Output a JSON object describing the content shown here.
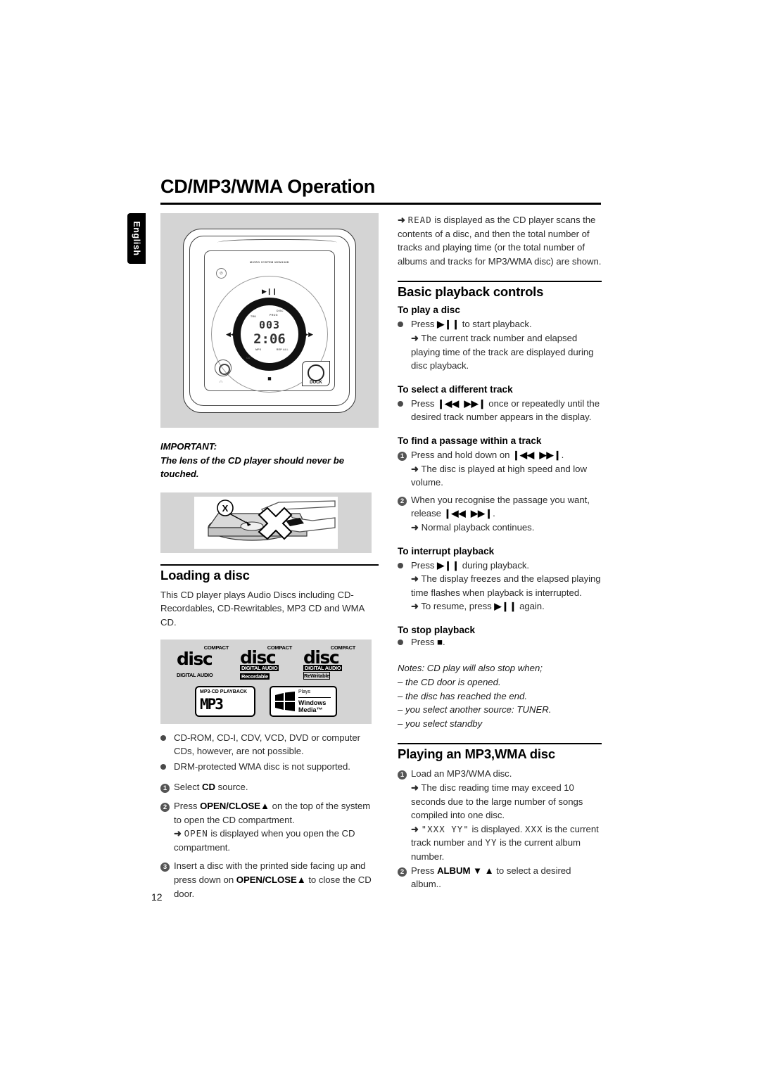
{
  "page": {
    "title": "CD/MP3/WMA Operation",
    "language_tab": "English",
    "page_number": "12"
  },
  "figures": {
    "device": {
      "model_label": "MICRO SYSTEM MCM138D",
      "display": {
        "track_number": "003",
        "elapsed_time": "2:06",
        "tag_trk": "TRK",
        "tag_prog": "PROG",
        "tag_disc": "DISC",
        "tag_mp3": "MP3",
        "tag_rep_all": "REP ALL",
        "tag_cd": "CD"
      },
      "buttons": {
        "standby": "⏻",
        "play_pause": "▶❙❙",
        "prev": "◀◀",
        "next": "▶▶",
        "stop": "■",
        "headphone": "∩",
        "dock": "DOCK"
      }
    },
    "lens_warning": {
      "mark": "X"
    },
    "logos": {
      "compact": "COMPACT",
      "disc": "disc",
      "digital_audio": "DIGITAL AUDIO",
      "recordable": "Recordable",
      "rewritable": "ReWritable",
      "mp3_playback": "MP3-CD PLAYBACK",
      "mp3": "MP3",
      "plays": "Plays",
      "windows": "Windows",
      "media": "Media™",
      "tm": "™"
    }
  },
  "left_column": {
    "important_label": "IMPORTANT:",
    "important_text": "The lens of the CD player should never be touched.",
    "loading_heading": "Loading a disc",
    "loading_intro": "This CD player plays Audio Discs including CD-Recordables, CD-Rewritables, MP3 CD and WMA CD.",
    "bullets": [
      "CD-ROM, CD-I, CDV, VCD, DVD or computer CDs, however, are not possible.",
      "DRM-protected WMA disc is not supported."
    ],
    "steps": [
      {
        "num": "1",
        "pre": "Select ",
        "bold": "CD",
        "post": " source."
      },
      {
        "num": "2",
        "pre": "Press ",
        "bold": "OPEN/CLOSE▲",
        "post": " on the top of the system to open the CD compartment."
      },
      {
        "num": "3",
        "pre": "Insert a disc with the printed side facing up and press down on ",
        "bold": "OPEN/CLOSE▲",
        "post": " to close the CD door."
      }
    ],
    "open_arrow": {
      "arrow": "➜",
      "lcd": "OPEN",
      "text": " is displayed when you open the CD compartment."
    }
  },
  "right_column": {
    "read_arrow": {
      "arrow": "➜",
      "lcd": "READ",
      "text": " is displayed as the CD player scans the contents of a disc, and then the total number of tracks and playing time (or the total number of albums and tracks for MP3/WMA disc) are shown."
    },
    "basic_heading": "Basic playback controls",
    "play_heading": "To play a disc",
    "play_bullet": {
      "pre": "Press ",
      "sym": "▶❙❙",
      "post": " to start playback."
    },
    "play_arrow": "The current track number and elapsed playing time of the track are displayed during disc playback.",
    "select_heading": "To select a different track",
    "select_bullet": {
      "pre": "Press ",
      "sym1": "❙◀◀",
      "sym2": "▶▶❙",
      "post": " once or repeatedly until the desired track number appears in the display."
    },
    "passage_heading": "To find a passage within a track",
    "passage_step1": {
      "num": "1",
      "pre": "Press and hold down on ",
      "sym1": "❙◀◀",
      "sym2": "▶▶❙",
      "post": "."
    },
    "passage_step1_arrow": "The disc is played at high speed and low volume.",
    "passage_step2": {
      "num": "2",
      "pre": "When you recognise the passage you want, release ",
      "sym1": "❙◀◀",
      "sym2": "▶▶❙",
      "post": "."
    },
    "passage_step2_arrow": "Normal playback continues.",
    "interrupt_heading": "To interrupt playback",
    "interrupt_bullet": {
      "pre": "Press ",
      "sym": "▶❙❙",
      "post": " during playback."
    },
    "interrupt_arrow1": "The display freezes and the elapsed playing time flashes when playback is interrupted.",
    "interrupt_arrow2": {
      "pre": "To resume, press ",
      "sym": "▶❙❙",
      "post": " again."
    },
    "stop_heading": "To stop playback",
    "stop_bullet": {
      "pre": "Press ",
      "sym": "■",
      "post": "."
    },
    "notes_title": "Notes: CD play will also stop when;",
    "notes_items": [
      "– the CD door is opened.",
      "– the disc has reached the end.",
      "– you select another source: TUNER.",
      "– you select standby"
    ],
    "mp3_heading": "Playing an MP3,WMA disc",
    "mp3_step1": {
      "num": "1",
      "text": "Load an MP3/WMA disc."
    },
    "mp3_step1_arrow": "The disc reading time may exceed 10 seconds due to the large number of songs compiled into one disc.",
    "mp3_step1_arrow2": {
      "q1": "\"XXX  YY\"",
      "mid": " is displayed. ",
      "q2": "XXX",
      "mid2": " is the current track number and ",
      "q3": "YY",
      "end": " is the current album number."
    },
    "mp3_step2": {
      "num": "2",
      "pre": "Press ",
      "bold": "ALBUM ▼ ▲",
      "post": " to select a desired album.."
    }
  }
}
